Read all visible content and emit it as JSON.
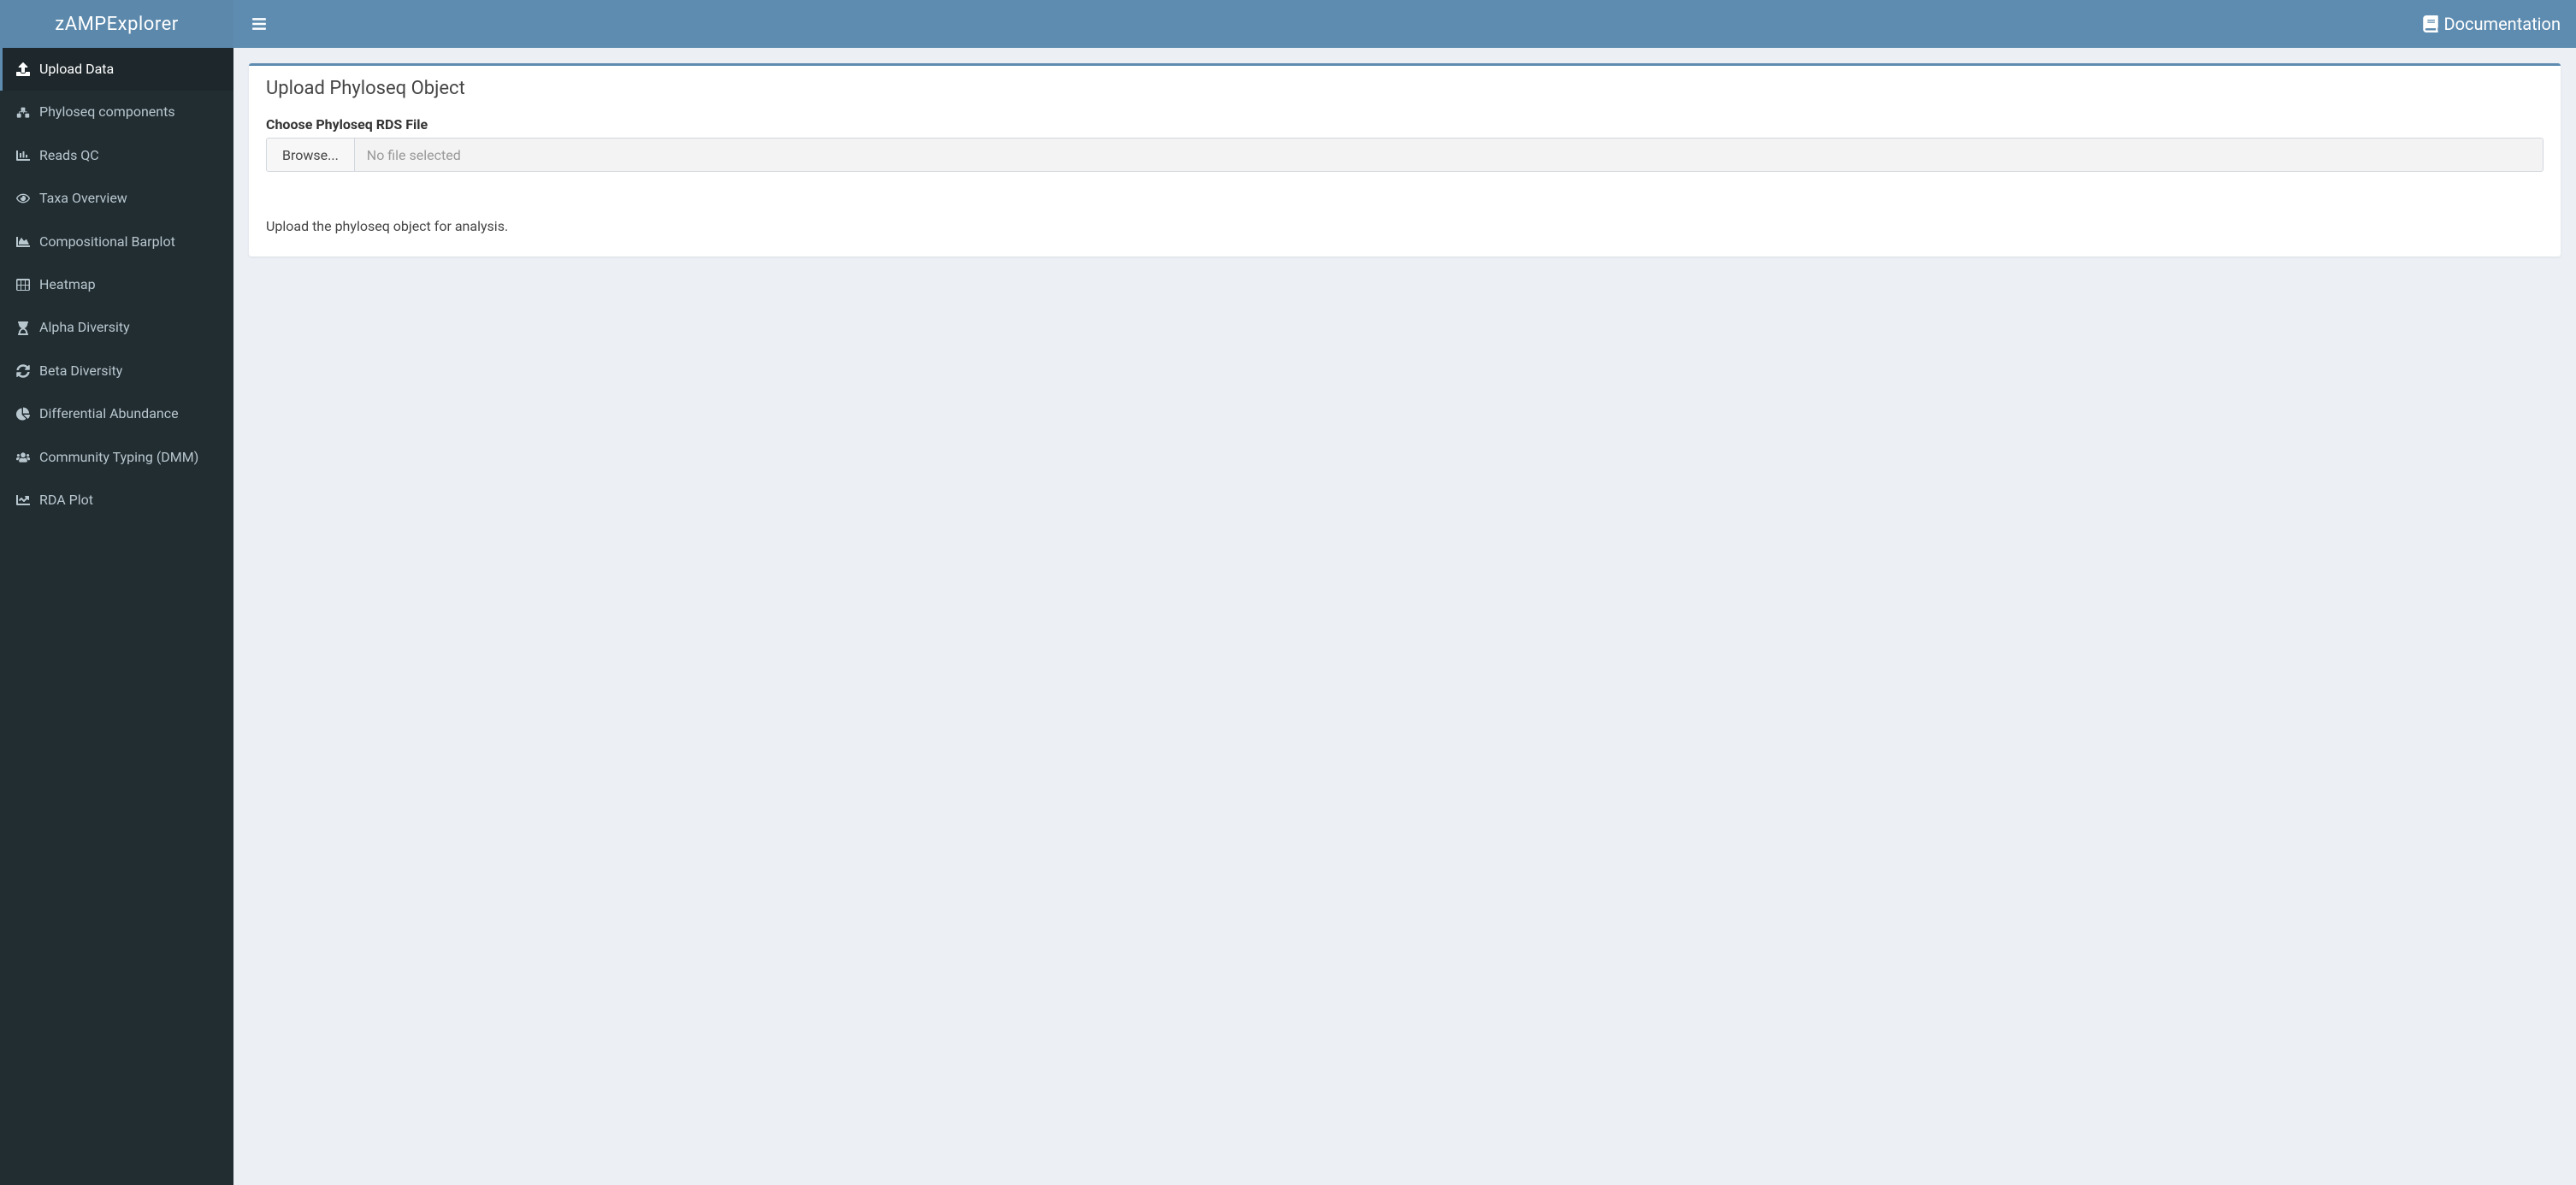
{
  "header": {
    "app_name": "zAMPExplorer",
    "documentation_label": "Documentation"
  },
  "sidebar": {
    "items": [
      {
        "label": "Upload Data",
        "icon": "upload-icon",
        "active": true
      },
      {
        "label": "Phyloseq components",
        "icon": "structure-icon",
        "active": false
      },
      {
        "label": "Reads QC",
        "icon": "bar-chart-icon",
        "active": false
      },
      {
        "label": "Taxa Overview",
        "icon": "eye-icon",
        "active": false
      },
      {
        "label": "Compositional Barplot",
        "icon": "area-chart-icon",
        "active": false
      },
      {
        "label": "Heatmap",
        "icon": "grid-icon",
        "active": false
      },
      {
        "label": "Alpha Diversity",
        "icon": "hourglass-icon",
        "active": false
      },
      {
        "label": "Beta Diversity",
        "icon": "shuffle-icon",
        "active": false
      },
      {
        "label": "Differential Abundance",
        "icon": "pie-chart-icon",
        "active": false
      },
      {
        "label": "Community Typing (DMM)",
        "icon": "users-icon",
        "active": false
      },
      {
        "label": "RDA Plot",
        "icon": "line-chart-icon",
        "active": false
      }
    ]
  },
  "main": {
    "panel_title": "Upload Phyloseq Object",
    "file_label": "Choose Phyloseq RDS File",
    "browse_label": "Browse...",
    "file_status": "No file selected",
    "help_text": "Upload the phyloseq object for analysis."
  }
}
